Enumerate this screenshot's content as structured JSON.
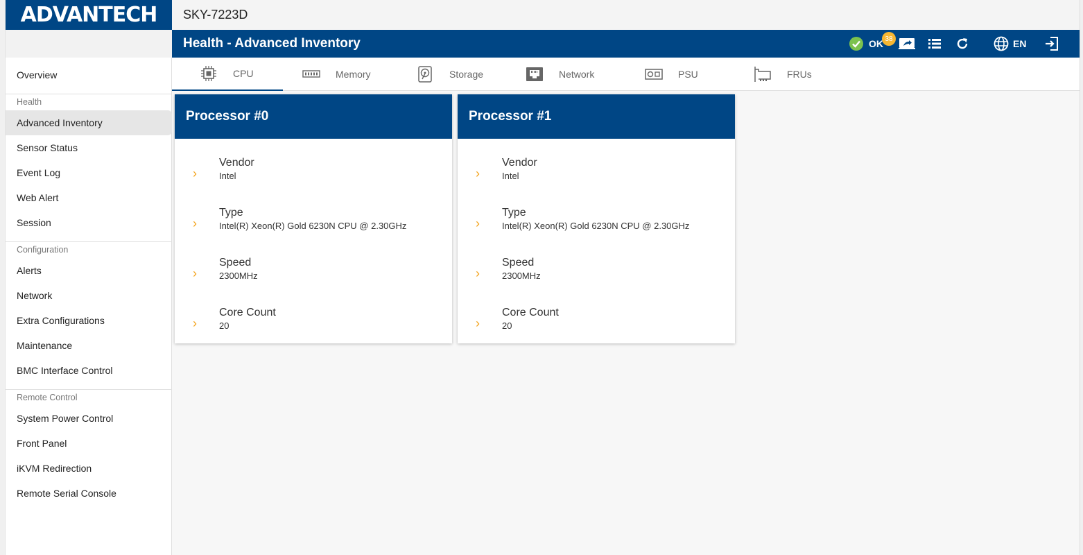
{
  "header": {
    "logo_text": "ADVANTECH",
    "device_name": "SKY-7223D",
    "page_title": "Health - Advanced Inventory",
    "status_label": "OK",
    "notification_count": "38",
    "language": "EN"
  },
  "sidebar": {
    "overview": "Overview",
    "sections": {
      "health": "Health",
      "configuration": "Configuration",
      "remote_control": "Remote Control"
    },
    "health_items": [
      "Advanced Inventory",
      "Sensor Status",
      "Event Log",
      "Web Alert",
      "Session"
    ],
    "configuration_items": [
      "Alerts",
      "Network",
      "Extra Configurations",
      "Maintenance",
      "BMC Interface Control"
    ],
    "remote_items": [
      "System Power Control",
      "Front Panel",
      "iKVM Redirection",
      "Remote Serial Console"
    ]
  },
  "tabs": [
    "CPU",
    "Memory",
    "Storage",
    "Network",
    "PSU",
    "FRUs"
  ],
  "processors": [
    {
      "title": "Processor #0",
      "fields": [
        {
          "label": "Vendor",
          "value": "Intel"
        },
        {
          "label": "Type",
          "value": "Intel(R) Xeon(R) Gold 6230N CPU @ 2.30GHz"
        },
        {
          "label": "Speed",
          "value": "2300MHz"
        },
        {
          "label": "Core Count",
          "value": "20"
        }
      ]
    },
    {
      "title": "Processor #1",
      "fields": [
        {
          "label": "Vendor",
          "value": "Intel"
        },
        {
          "label": "Type",
          "value": "Intel(R) Xeon(R) Gold 6230N CPU @ 2.30GHz"
        },
        {
          "label": "Speed",
          "value": "2300MHz"
        },
        {
          "label": "Core Count",
          "value": "20"
        }
      ]
    }
  ],
  "colors": {
    "brand_blue": "#004685",
    "accent_orange": "#f4a31c",
    "status_green": "#7cc24e",
    "badge_yellow": "#f7b733"
  }
}
